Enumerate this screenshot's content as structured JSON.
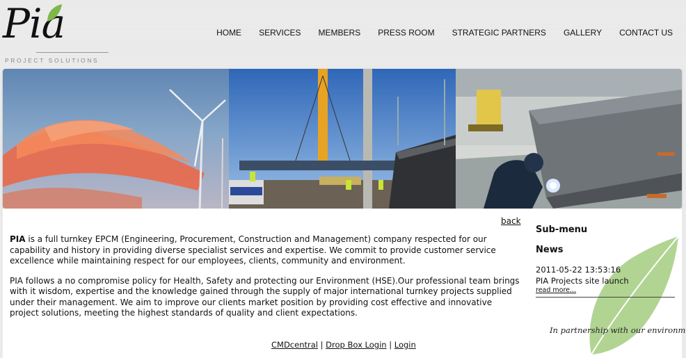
{
  "brand": {
    "name": "Pia",
    "tagline": "PROJECT SOLUTIONS",
    "leaf_color": "#7fb84a"
  },
  "nav": {
    "items": [
      {
        "label": "HOME"
      },
      {
        "label": "SERVICES"
      },
      {
        "label": "MEMBERS"
      },
      {
        "label": "PRESS ROOM"
      },
      {
        "label": "STRATEGIC PARTNERS"
      },
      {
        "label": "GALLERY"
      },
      {
        "label": "CONTACT US"
      }
    ]
  },
  "main": {
    "back_label": "back",
    "para1_bold": "PIA",
    "para1_rest": " is a full turnkey EPCM (Engineering, Procurement, Construction and Management) company respected for our capability and history in providing diverse specialist services and expertise. We commit to provide customer service excellence while maintaining respect for our employees, clients, community and environment.",
    "para2": "PIA follows a no compromise policy for Health, Safety and protecting our Environment (HSE).Our professional team brings with it wisdom, expertise and the knowledge gained through the supply of major international turnkey projects supplied under their management. We aim to improve our clients market position by providing cost effective and innovative project solutions, meeting the highest standards of quality and client expectations."
  },
  "footer": {
    "link1": "CMDcentral",
    "sep": "|",
    "link2": "Drop Box Login",
    "link3": "Login"
  },
  "sidebar": {
    "submenu_title": "Sub-menu",
    "news_title": "News",
    "news": {
      "date": "2011-05-22 13:53:16",
      "title": "PIA Projects site launch",
      "read_more": "read more..."
    },
    "partnership": "In partnership with our environment"
  }
}
